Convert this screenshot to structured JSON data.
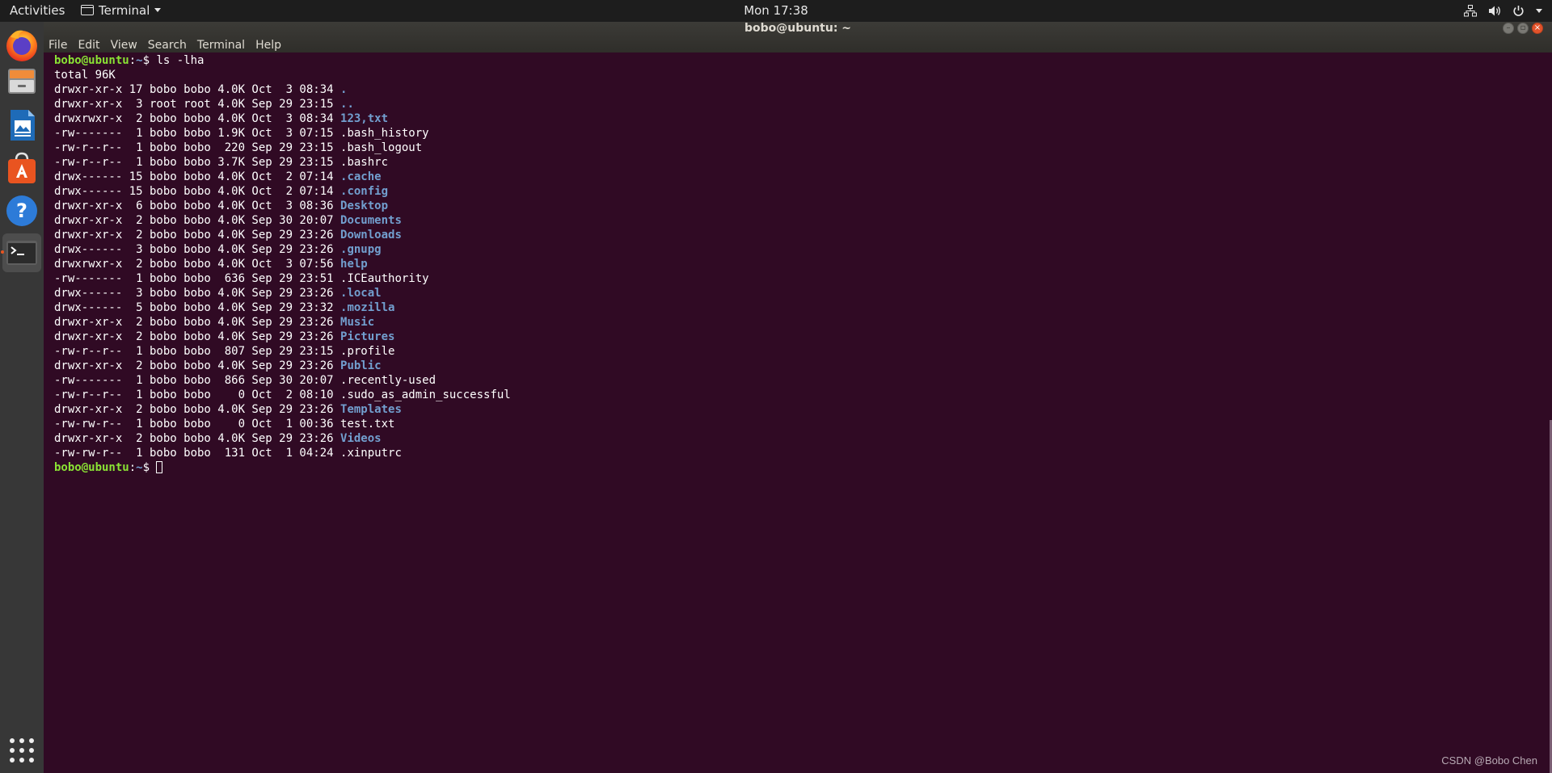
{
  "topbar": {
    "activities": "Activities",
    "app_name": "Terminal",
    "clock": "Mon 17:38"
  },
  "dock": {
    "items": [
      "firefox-icon",
      "files-icon",
      "writer-icon",
      "software-icon",
      "help-icon",
      "terminal-icon"
    ],
    "show_apps": "grid-icon"
  },
  "window": {
    "title": "bobo@ubuntu: ~",
    "menu": [
      "File",
      "Edit",
      "View",
      "Search",
      "Terminal",
      "Help"
    ]
  },
  "colors": {
    "terminal_bg": "#300a24",
    "prompt_user": "#8ae234",
    "prompt_path": "#729fcf",
    "directory": "#729fcf",
    "close_button": "#e2532b"
  },
  "terminal": {
    "prompt_user": "bobo@ubuntu",
    "prompt_path": "~",
    "prompt_sep": ":",
    "prompt_symbol": "$ ",
    "command": "ls -lha",
    "total": "total 96K",
    "listing": [
      {
        "meta": "drwxr-xr-x 17 bobo bobo 4.0K Oct  3 08:34 ",
        "name": ".",
        "dir": true
      },
      {
        "meta": "drwxr-xr-x  3 root root 4.0K Sep 29 23:15 ",
        "name": "..",
        "dir": true
      },
      {
        "meta": "drwxrwxr-x  2 bobo bobo 4.0K Oct  3 08:34 ",
        "name": "123,txt",
        "dir": true
      },
      {
        "meta": "-rw-------  1 bobo bobo 1.9K Oct  3 07:15 ",
        "name": ".bash_history",
        "dir": false
      },
      {
        "meta": "-rw-r--r--  1 bobo bobo  220 Sep 29 23:15 ",
        "name": ".bash_logout",
        "dir": false
      },
      {
        "meta": "-rw-r--r--  1 bobo bobo 3.7K Sep 29 23:15 ",
        "name": ".bashrc",
        "dir": false
      },
      {
        "meta": "drwx------ 15 bobo bobo 4.0K Oct  2 07:14 ",
        "name": ".cache",
        "dir": true
      },
      {
        "meta": "drwx------ 15 bobo bobo 4.0K Oct  2 07:14 ",
        "name": ".config",
        "dir": true
      },
      {
        "meta": "drwxr-xr-x  6 bobo bobo 4.0K Oct  3 08:36 ",
        "name": "Desktop",
        "dir": true
      },
      {
        "meta": "drwxr-xr-x  2 bobo bobo 4.0K Sep 30 20:07 ",
        "name": "Documents",
        "dir": true
      },
      {
        "meta": "drwxr-xr-x  2 bobo bobo 4.0K Sep 29 23:26 ",
        "name": "Downloads",
        "dir": true
      },
      {
        "meta": "drwx------  3 bobo bobo 4.0K Sep 29 23:26 ",
        "name": ".gnupg",
        "dir": true
      },
      {
        "meta": "drwxrwxr-x  2 bobo bobo 4.0K Oct  3 07:56 ",
        "name": "help",
        "dir": true
      },
      {
        "meta": "-rw-------  1 bobo bobo  636 Sep 29 23:51 ",
        "name": ".ICEauthority",
        "dir": false
      },
      {
        "meta": "drwx------  3 bobo bobo 4.0K Sep 29 23:26 ",
        "name": ".local",
        "dir": true
      },
      {
        "meta": "drwx------  5 bobo bobo 4.0K Sep 29 23:32 ",
        "name": ".mozilla",
        "dir": true
      },
      {
        "meta": "drwxr-xr-x  2 bobo bobo 4.0K Sep 29 23:26 ",
        "name": "Music",
        "dir": true
      },
      {
        "meta": "drwxr-xr-x  2 bobo bobo 4.0K Sep 29 23:26 ",
        "name": "Pictures",
        "dir": true
      },
      {
        "meta": "-rw-r--r--  1 bobo bobo  807 Sep 29 23:15 ",
        "name": ".profile",
        "dir": false
      },
      {
        "meta": "drwxr-xr-x  2 bobo bobo 4.0K Sep 29 23:26 ",
        "name": "Public",
        "dir": true
      },
      {
        "meta": "-rw-------  1 bobo bobo  866 Sep 30 20:07 ",
        "name": ".recently-used",
        "dir": false
      },
      {
        "meta": "-rw-r--r--  1 bobo bobo    0 Oct  2 08:10 ",
        "name": ".sudo_as_admin_successful",
        "dir": false
      },
      {
        "meta": "drwxr-xr-x  2 bobo bobo 4.0K Sep 29 23:26 ",
        "name": "Templates",
        "dir": true
      },
      {
        "meta": "-rw-rw-r--  1 bobo bobo    0 Oct  1 00:36 ",
        "name": "test.txt",
        "dir": false
      },
      {
        "meta": "drwxr-xr-x  2 bobo bobo 4.0K Sep 29 23:26 ",
        "name": "Videos",
        "dir": true
      },
      {
        "meta": "-rw-rw-r--  1 bobo bobo  131 Oct  1 04:24 ",
        "name": ".xinputrc",
        "dir": false
      }
    ]
  },
  "watermark": "CSDN @Bobo Chen"
}
